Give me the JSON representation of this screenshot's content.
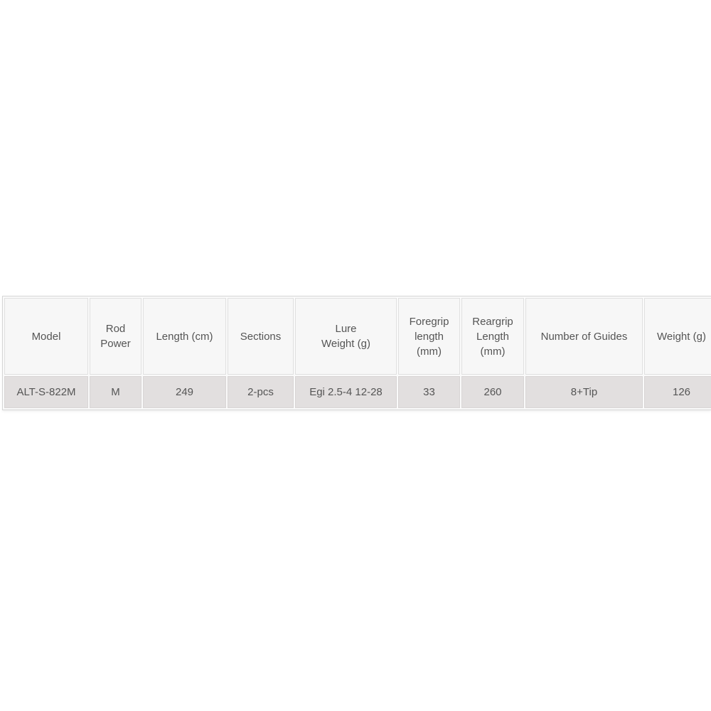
{
  "table": {
    "headers": [
      "Model",
      "Rod Power",
      "Length (cm)",
      "Sections",
      "Lure Weight (g)",
      "Foregrip length (mm)",
      "Reargrip Length (mm)",
      "Number of Guides",
      "Weight (g)"
    ],
    "rows": [
      [
        "ALT-S-822M",
        "M",
        "249",
        "2-pcs",
        "Egi 2.5-4 12-28",
        "33",
        "260",
        "8+Tip",
        "126"
      ]
    ]
  },
  "colors": {
    "header_bg": "#f7f7f7",
    "row_bg": "#e2dfdf",
    "text": "#555555",
    "border": "#d6d6d6"
  }
}
